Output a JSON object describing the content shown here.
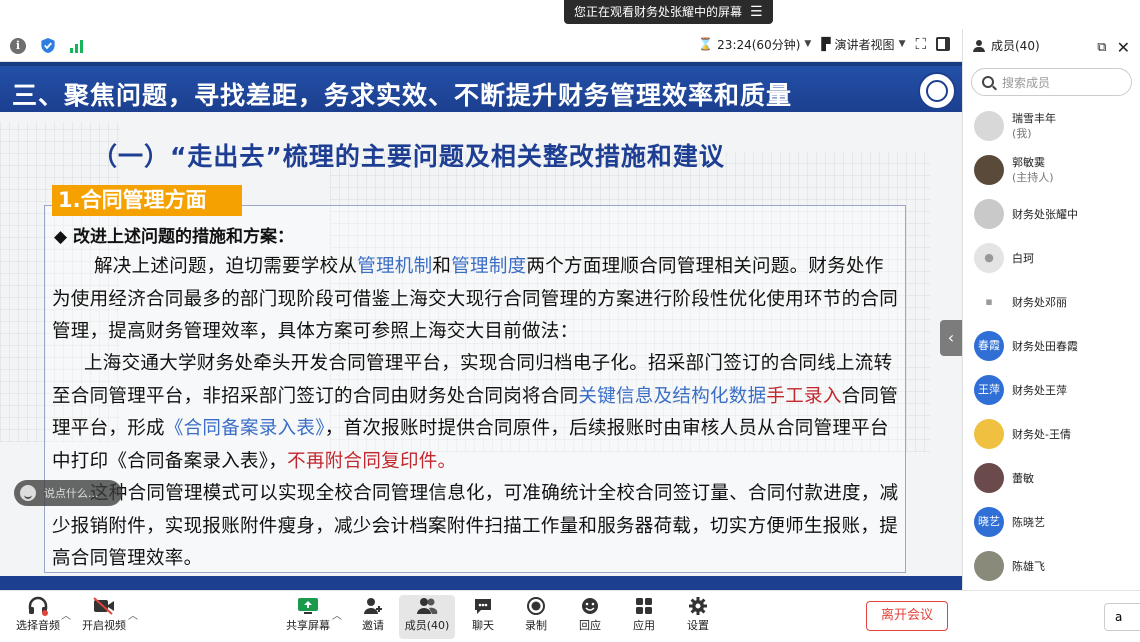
{
  "banner": {
    "sharing_text": "您正在观看财务处张耀中的屏幕"
  },
  "toolbar": {
    "timer": "23:24(60分钟)",
    "view_mode": "演讲者视图"
  },
  "slide": {
    "header_title": "三、聚焦问题，寻找差距，务求实效、不断提升财务管理效率和质量",
    "subtitle": "（一）“走出去”梳理的主要问题及相关整改措施和建议",
    "section_tag": "1.合同管理方面",
    "bullet_heading": "◆ 改进上述问题的措施和方案：",
    "p1_a": "解决上述问题，迫切需要学校从",
    "p1_b": "管理机制",
    "p1_c": "和",
    "p1_d": "管理制度",
    "p1_e": "两个方面理顺合同管理相关问题。财务处作为使用经济合同最多的部门现阶段可借鉴上海交大现行合同管理的方案进行阶段性优化使用环节的合同管理，提高财务管理效率，具体方案可参照上海交大目前做法：",
    "p2_a": "上海交通大学财务处牵头开发合同管理平台，实现合同归档电子化。招采部门签订的合同线上流转至合同管理平台，非招采部门签订的合同由财务处合同岗将合同",
    "p2_b": "关键信息及结构化数据",
    "p2_c": "手工录入",
    "p2_d": "合同管理平台，形成",
    "p2_e": "《合同备案录入表》",
    "p2_f": "，首次报账时提供合同原件，后续报账时由审核人员从合同管理平台中打印《合同备案录入表》，",
    "p2_g": "不再附合同复印件。",
    "p3": "这种合同管理模式可以实现全校合同管理信息化，可准确统计全校合同签订量、合同付款进度，减少报销附件，实现报账附件瘦身，减少会计档案附件扫描工作量和服务器荷载，切实方便师生报账，提高合同管理效率。"
  },
  "comment": {
    "placeholder": "说点什么..."
  },
  "members": {
    "title": "成员(40)",
    "search_placeholder": "搜索成员",
    "list": [
      {
        "name": "瑞雪丰年",
        "sub": "(我)",
        "avatar_text": "",
        "color": "#d8d8d8"
      },
      {
        "name": "郭敏霙",
        "sub": "(主持人)",
        "avatar_text": "",
        "color": "#5a4a3a"
      },
      {
        "name": "财务处张耀中",
        "sub": "",
        "avatar_text": "",
        "color": "#c9c9c9"
      },
      {
        "name": "白珂",
        "sub": "",
        "avatar_text": "",
        "color": "#e4e4e4"
      },
      {
        "name": "财务处邓丽",
        "sub": "",
        "avatar_text": "",
        "color": "#ffffff"
      },
      {
        "name": "财务处田春霞",
        "sub": "",
        "avatar_text": "春霞",
        "color": "#2f6fd6"
      },
      {
        "name": "财务处王萍",
        "sub": "",
        "avatar_text": "王萍",
        "color": "#2f6fd6"
      },
      {
        "name": "财务处-王倩",
        "sub": "",
        "avatar_text": "",
        "color": "#f0c040"
      },
      {
        "name": "蕾敏",
        "sub": "",
        "avatar_text": "",
        "color": "#6a4a4a"
      },
      {
        "name": "陈晓艺",
        "sub": "",
        "avatar_text": "晓艺",
        "color": "#2f6fd6"
      },
      {
        "name": "陈雄飞",
        "sub": "",
        "avatar_text": "",
        "color": "#8a8a7a"
      }
    ]
  },
  "controls": {
    "audio": "选择音频",
    "video": "开启视频",
    "share": "共享屏幕",
    "invite": "邀请",
    "members": "成员(40)",
    "chat": "聊天",
    "record": "录制",
    "react": "回应",
    "apps": "应用",
    "settings": "设置",
    "leave": "离开会议"
  }
}
